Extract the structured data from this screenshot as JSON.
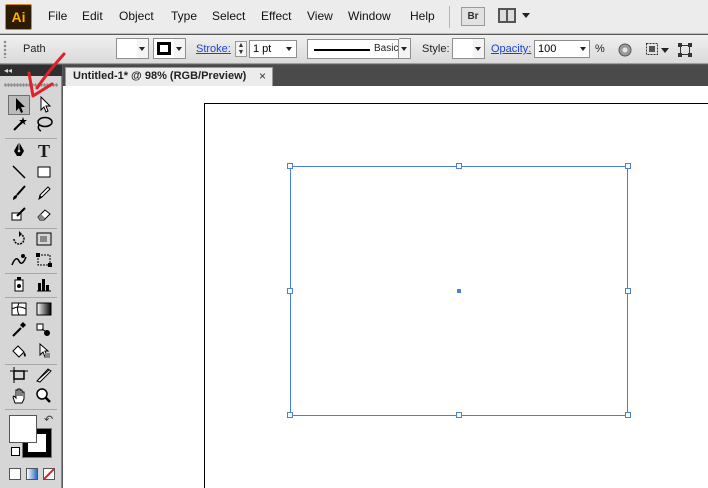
{
  "app": {
    "logo_text": "Ai",
    "bridge_label": "Br",
    "menu": [
      "File",
      "Edit",
      "Object",
      "Type",
      "Select",
      "Effect",
      "View",
      "Window",
      "Help"
    ]
  },
  "control_bar": {
    "selection_type": "Path",
    "stroke_label": "Stroke:",
    "stroke_weight": "1 pt",
    "brush_label": "Basic",
    "style_label": "Style:",
    "opacity_label": "Opacity:",
    "opacity_value": "100",
    "opacity_unit": "%"
  },
  "document": {
    "tab_title": "Untitled-1* @ 98% (RGB/Preview)",
    "close_glyph": "×"
  },
  "tools_panel": {
    "collapse_glyph": "◂◂",
    "swap_glyph": "↶"
  },
  "colors": {
    "selection": "#4a7fdc",
    "annotation_arrow": "#e0202a",
    "logo_bg": "#2b1b00",
    "logo_fg": "#ffae00",
    "link_blue": "#1f44c8"
  }
}
